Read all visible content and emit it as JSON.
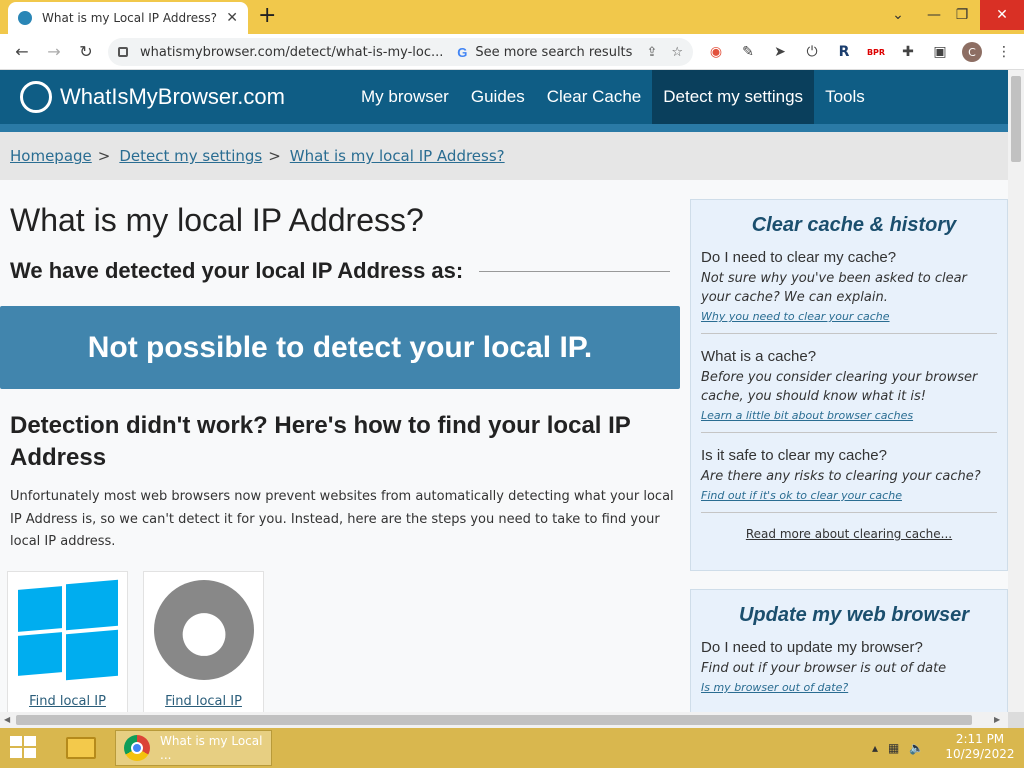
{
  "browser": {
    "tab_title": "What is my Local IP Address? - W",
    "url": "whatismybrowser.com/detect/what-is-my-loc...",
    "search_prompt": "See more search results",
    "profile_initial": "C"
  },
  "site": {
    "logo": "WhatIsMyBrowser.com",
    "nav": [
      "My browser",
      "Guides",
      "Clear Cache",
      "Detect my settings",
      "Tools"
    ],
    "active_nav": "Detect my settings"
  },
  "breadcrumb": [
    "Homepage",
    "Detect my settings",
    "What is my local IP Address?"
  ],
  "main": {
    "title": "What is my local IP Address?",
    "detected_heading": "We have detected your local IP Address as:",
    "result": "Not possible to detect your local IP.",
    "howto_heading": "Detection didn't work? Here's how to find your local IP Address",
    "paragraph": "Unfortunately most web browsers now prevent websites from automatically detecting what your local IP Address is, so we can't detect it for you. Instead, here are the steps you need to take to find your local IP address.",
    "cards": [
      {
        "label": "Find local IP",
        "icon": "windows-logo"
      },
      {
        "label": "Find local IP",
        "icon": "apple-logo"
      }
    ]
  },
  "sidebar": {
    "clear_cache": {
      "title": "Clear cache & history",
      "items": [
        {
          "q": "Do I need to clear my cache?",
          "a": "Not sure why you've been asked to clear your cache? We can explain.",
          "link": "Why you need to clear your cache"
        },
        {
          "q": "What is a cache?",
          "a": "Before you consider clearing your browser cache, you should know what it is!",
          "link": "Learn a little bit about browser caches"
        },
        {
          "q": "Is it safe to clear my cache?",
          "a": "Are there any risks to clearing your cache?",
          "link": "Find out if it's ok to clear your cache"
        }
      ],
      "read_more": "Read more about clearing cache..."
    },
    "update": {
      "title": "Update my web browser",
      "items": [
        {
          "q": "Do I need to update my browser?",
          "a": "Find out if your browser is out of date",
          "link": "Is my browser out of date?"
        }
      ]
    }
  },
  "taskbar": {
    "app_label": "What is my Local ...",
    "time": "2:11 PM",
    "date": "10/29/2022"
  },
  "colors": {
    "header": "#0f5d85",
    "result_box": "#4185ad",
    "taskbar": "#d9b74e",
    "tabstrip": "#f1c84b"
  }
}
